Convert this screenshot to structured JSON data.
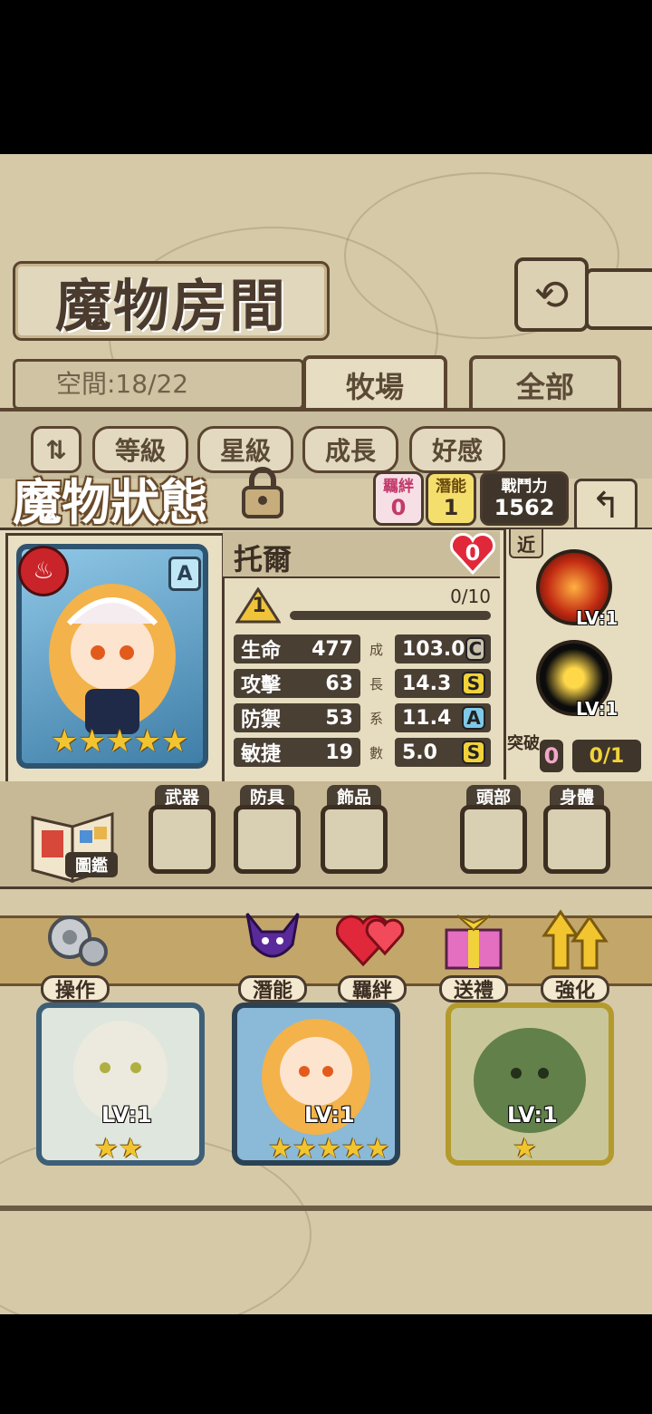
{
  "header": {
    "title": "魔物房間",
    "back_icon": "return-arrow-icon"
  },
  "inventory": {
    "space": "空間:18/22"
  },
  "tabs": [
    {
      "label": "牧場"
    },
    {
      "label": "全部"
    }
  ],
  "filters": [
    {
      "label": "等級"
    },
    {
      "label": "星級"
    },
    {
      "label": "成長"
    },
    {
      "label": "好感"
    }
  ],
  "status": {
    "title": "魔物狀態",
    "bond": {
      "label": "羈絆",
      "value": "0"
    },
    "potential": {
      "label": "潛能",
      "value": "1"
    },
    "power": {
      "label": "戰鬥力",
      "value": "1562"
    }
  },
  "monster": {
    "name": "托爾",
    "affection": "0",
    "rank": "A",
    "element_icon": "fire-icon",
    "stars": 5,
    "level_badge": "1",
    "exp": "0/10",
    "exp_fraction": 0.0,
    "stats": [
      {
        "label": "生命",
        "value": "477",
        "growth": "103.0",
        "grade": "C",
        "grade_color": "#c9c0ad"
      },
      {
        "label": "攻擊",
        "value": "63",
        "growth": "14.3",
        "grade": "S",
        "grade_color": "#f2d23a"
      },
      {
        "label": "防禦",
        "value": "53",
        "growth": "11.4",
        "grade": "A",
        "grade_color": "#7fc8e8"
      },
      {
        "label": "敏捷",
        "value": "19",
        "growth": "5.0",
        "grade": "S",
        "grade_color": "#f2d23a"
      }
    ],
    "growth_label": [
      "成",
      "長",
      "系",
      "數"
    ]
  },
  "skills": {
    "range": "近",
    "items": [
      {
        "level": "LV:1"
      },
      {
        "level": "LV:1"
      }
    ],
    "breakthrough_label": "突破",
    "breakthrough_count": "0",
    "breakthrough_progress": "0/1"
  },
  "equipment": {
    "book_label": "圖鑑",
    "slots": [
      {
        "label": "武器"
      },
      {
        "label": "防具"
      },
      {
        "label": "飾品"
      },
      {
        "label": "頭部"
      },
      {
        "label": "身體"
      }
    ]
  },
  "actions": [
    {
      "label": "操作",
      "icon": "gear-icon"
    },
    {
      "label": "潛能",
      "icon": "demon-icon"
    },
    {
      "label": "羈絆",
      "icon": "hearts-icon"
    },
    {
      "label": "送禮",
      "icon": "gift-icon"
    },
    {
      "label": "強化",
      "icon": "upgrade-arrows-icon"
    }
  ],
  "cards": [
    {
      "level": "LV:1",
      "stars": 2
    },
    {
      "level": "LV:1",
      "stars": 5
    },
    {
      "level": "LV:1",
      "stars": 1
    }
  ]
}
